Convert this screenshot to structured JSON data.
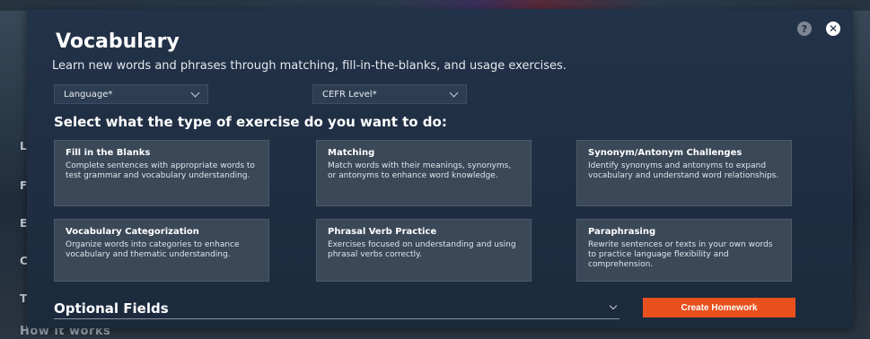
{
  "backdrop": {
    "side_letters": [
      "L",
      "F",
      "E",
      "C",
      "T"
    ],
    "footer_text": "How it works"
  },
  "modal": {
    "title": "Vocabulary",
    "subtitle": "Learn new words and phrases through matching, fill-in-the-blanks, and usage exercises.",
    "help_icon": "?",
    "close_icon": "✕"
  },
  "filters": {
    "language_label": "Language*",
    "cefr_label": "CEFR Level*"
  },
  "section_heading": "Select what the type of exercise do you want to do:",
  "exercises": [
    {
      "title": "Fill in the Blanks",
      "description": "Complete sentences with appropriate words to test grammar and vocabulary understanding."
    },
    {
      "title": "Matching",
      "description": "Match words with their meanings, synonyms, or antonyms to enhance word knowledge."
    },
    {
      "title": "Synonym/Antonym Challenges",
      "description": "Identify synonyms and antonyms to expand vocabulary and understand word relationships."
    },
    {
      "title": "Vocabulary Categorization",
      "description": "Organize words into categories to enhance vocabulary and thematic understanding."
    },
    {
      "title": "Phrasal Verb Practice",
      "description": "Exercises focused on understanding and using phrasal verbs correctly."
    },
    {
      "title": "Paraphrasing",
      "description": "Rewrite sentences or texts in your own words to practice language flexibility and comprehension."
    }
  ],
  "optional_fields_label": "Optional Fields",
  "create_button_label": "Create Homework",
  "colors": {
    "accent": "#e8501e",
    "modal_bg": "#1c2a3d",
    "card_bg": "#3a4858"
  }
}
